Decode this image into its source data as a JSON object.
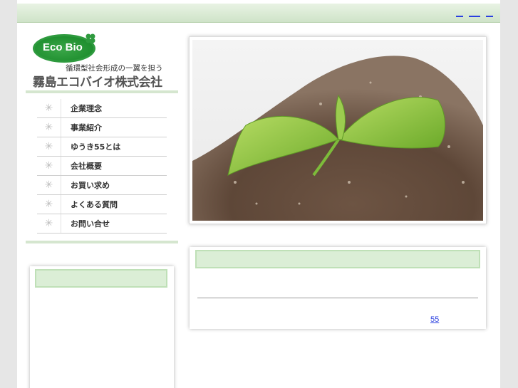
{
  "colors": {
    "accent_green": "#2e9a3e",
    "band_green": "#cfe3c8",
    "link_blue": "#2a3fe0"
  },
  "header": {
    "links": [
      "",
      "",
      ""
    ]
  },
  "logo": {
    "text": "Eco Bio",
    "tagline": "循環型社会形成の一翼を担う",
    "company_name": "霧島エコバイオ株式会社"
  },
  "nav": {
    "items": [
      {
        "icon": "sparkle-icon",
        "label": "企業理念"
      },
      {
        "icon": "sparkle-icon",
        "label": "事業紹介"
      },
      {
        "icon": "sparkle-icon",
        "label": "ゆうき55とは"
      },
      {
        "icon": "sparkle-icon",
        "label": "会社概要"
      },
      {
        "icon": "sparkle-icon",
        "label": "お買い求め"
      },
      {
        "icon": "sparkle-icon",
        "label": "よくある質問"
      },
      {
        "icon": "sparkle-icon",
        "label": "お問い合せ"
      }
    ]
  },
  "main_panel": {
    "link_text": "55"
  }
}
